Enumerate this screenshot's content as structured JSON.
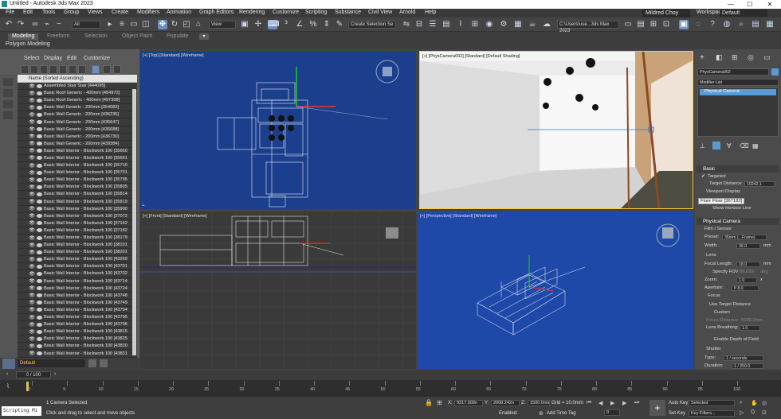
{
  "window": {
    "title": "Untitled - Autodesk 3ds Max 2023",
    "minimize": "—",
    "maximize": "☐",
    "close": "✕"
  },
  "menu": {
    "items": [
      "File",
      "Edit",
      "Tools",
      "Group",
      "Views",
      "Create",
      "Modifiers",
      "Animation",
      "Graph Editors",
      "Rendering",
      "Customize",
      "Scripting",
      "Substance",
      "Civil View",
      "Arnold",
      "Help"
    ],
    "user": "Mildred Choy",
    "workspaces_label": "Workspaces:",
    "workspace": "Default"
  },
  "toolbar": {
    "filter": "All",
    "ref_coord": "View",
    "selection_set": "Create Selection Se",
    "path": "C:\\Users\\use...3ds Max 2023"
  },
  "ribbon": {
    "tabs": [
      "Modeling",
      "Freeform",
      "Selection",
      "Object Paint",
      "Populate"
    ],
    "sub": "Polygon Modeling"
  },
  "explorer": {
    "menu": [
      "Select",
      "Display",
      "Edit",
      "Customize"
    ],
    "column": "Name (Sorted Ascending)",
    "rows": [
      "Assembled Stair Stair [444095]",
      "Basic Roof Generic - 400mm [454972]",
      "Basic Roof Generic - 400mm [497308]",
      "Basic Wall Generic - 200mm [354083]",
      "Basic Wall Generic - 200mm [436235]",
      "Basic Wall Generic - 200mm [436647]",
      "Basic Wall Generic - 200mm [436688]",
      "Basic Wall Generic - 200mm [436730]",
      "Basic Wall Generic - 200mm [439384]",
      "Basic Wall Interior - Blockwork 100 [35660",
      "Basic Wall Interior - Blockwork 100 [35661",
      "Basic Wall Interior - Blockwork 100 [35710",
      "Basic Wall Interior - Blockwork 100 [35731",
      "Basic Wall Interior - Blockwork 100 [35795",
      "Basic Wall Interior - Blockwork 100 [35805",
      "Basic Wall Interior - Blockwork 100 [35814",
      "Basic Wall Interior - Blockwork 100 [35819",
      "Basic Wall Interior - Blockwork 100 [35900",
      "Basic Wall Interior - Blockwork 100 [37072",
      "Basic Wall Interior - Blockwork 100 [37142",
      "Basic Wall Interior - Blockwork 100 [37182",
      "Basic Wall Interior - Blockwork 100 [38179",
      "Basic Wall Interior - Blockwork 100 [38191",
      "Basic Wall Interior - Blockwork 100 [38201",
      "Basic Wall Interior - Blockwork 100 [43269",
      "Basic Wall Interior - Blockwork 100 [43701",
      "Basic Wall Interior - Blockwork 100 [43702",
      "Basic Wall Interior - Blockwork 100 [43714",
      "Basic Wall Interior - Blockwork 100 [43724",
      "Basic Wall Interior - Blockwork 100 [43748",
      "Basic Wall Interior - Blockwork 100 [43749",
      "Basic Wall Interior - Blockwork 100 [43794",
      "Basic Wall Interior - Blockwork 100 [43795",
      "Basic Wall Interior - Blockwork 100 [43796",
      "Basic Wall Interior - Blockwork 100 [43815",
      "Basic Wall Interior - Blockwork 100 [43825",
      "Basic Wall Interior - Blockwork 100 [43830",
      "Basic Wall Interior - Blockwork 100 [43831"
    ],
    "layer": "Default"
  },
  "viewports": {
    "top": "[+] [Top] [Standard] [Wireframe]",
    "camera": "[+] [PhysCamera002] [Standard] [Default Shading]",
    "front": "[+] [Front] [Standard] [Wireframe]",
    "perspective": "[+] [Perspective] [Standard] [Wireframe]"
  },
  "command": {
    "object_name": "PhysCamera002",
    "modifier_list": "Modifier List",
    "stack_item": "Physical Camera",
    "basic": "Basic",
    "targeted": "Targeted",
    "target_distance_label": "Target Distance:",
    "target_distance": "10242.1",
    "viewport_display": "Viewport Display",
    "tooltip": "Floor Floor [367182]",
    "show_horizon": "Show Horizon Line",
    "physical_camera": "Physical Camera",
    "film_sensor": "Film / Sensor",
    "preset_label": "Preset:",
    "preset": "35mm (...Frame)",
    "width_label": "Width:",
    "width": "36.0",
    "width_unit": "mm",
    "lens": "Lens",
    "focal_label": "Focal Length:",
    "focal": "18.0",
    "focal_unit": "mm",
    "specify_fov": "Specify FOV",
    "fov": "89.899",
    "fov_unit": "deg",
    "zoom_label": "Zoom:",
    "zoom": "1.0",
    "zoom_unit": "x",
    "aperture_label": "Aperture:",
    "aperture": "f/ 8.0",
    "focus": "Focus",
    "use_target": "Use Target Distance",
    "custom": "Custom",
    "focus_dist_label": "Focus Distance:",
    "focus_dist": "5000.0mm",
    "lens_breathing_label": "Lens Breathing:",
    "lens_breathing": "1.0",
    "enable_dof": "Enable Depth of Field",
    "shutter": "Shutter",
    "type_label": "Type:",
    "type": "1 / seconds",
    "duration_label": "Duration:",
    "duration": "1 / 250.0"
  },
  "timeline": {
    "frame": "0 / 100",
    "ticks": [
      "0",
      "5",
      "10",
      "15",
      "20",
      "25",
      "30",
      "35",
      "40",
      "45",
      "50",
      "55",
      "60",
      "65",
      "70",
      "75",
      "80",
      "85",
      "90",
      "95",
      "100"
    ]
  },
  "status": {
    "script": "Scripting Mi",
    "selected": "1 Camera Selected",
    "prompt": "Click and drag to select and move objects",
    "x_label": "X:",
    "x": "9317.009n",
    "y_label": "Y:",
    "y": "2008.242n",
    "z_label": "Z:",
    "z": "1500.0mm",
    "grid": "Grid = 10.0mm",
    "enabled": "Enabled:",
    "add_time_tag": "Add Time Tag",
    "auto_key": "Auto Key",
    "set_key": "Set Key",
    "selected_combo": "Selected",
    "key_filters": "Key Filters...",
    "frame_field": "0"
  },
  "colors": {
    "viewport_blue": "#1a3f8f",
    "accent": "#5b9bd5",
    "panel": "#4b4b4b"
  }
}
